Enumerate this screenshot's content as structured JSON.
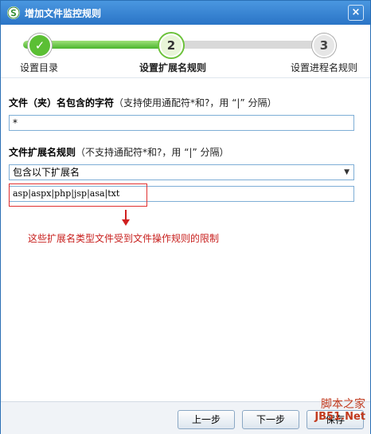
{
  "window": {
    "title": "增加文件监控规则",
    "close_glyph": "×"
  },
  "steps": [
    {
      "number": "✓",
      "label": "设置目录",
      "state": "done"
    },
    {
      "number": "2",
      "label": "设置扩展名规则",
      "state": "active"
    },
    {
      "number": "3",
      "label": "设置进程名规则",
      "state": "todo"
    }
  ],
  "folder_section": {
    "label": "文件（夹）名包含的字符",
    "hint": "（支持使用通配符*和?，用 “|” 分隔）",
    "value": "*"
  },
  "ext_section": {
    "label": "文件扩展名规则",
    "hint": "（不支持通配符*和?，用 “|” 分隔）",
    "select_value": "包含以下扩展名",
    "ext_value": "asp|aspx|php|jsp|asa|txt"
  },
  "annotation": {
    "note": "这些扩展名类型文件受到文件操作规则的限制",
    "color": "#c8201e"
  },
  "footer": {
    "prev_label": "上一步",
    "next_label": "下一步",
    "save_label": "保存"
  },
  "watermark": {
    "line1": "脚本之家",
    "line2": "JB51.Net"
  },
  "colors": {
    "titlebar": "#2a74c6",
    "step_done": "#5bbf34",
    "highlight": "#e03030"
  }
}
